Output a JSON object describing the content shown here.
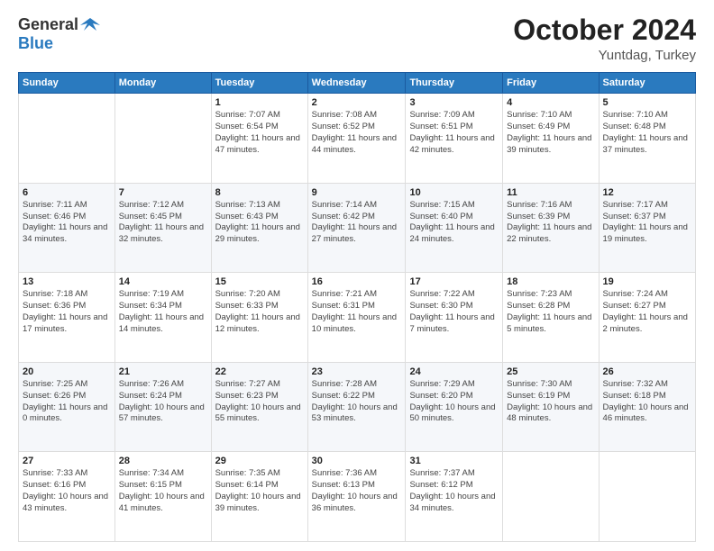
{
  "header": {
    "logo_general": "General",
    "logo_blue": "Blue",
    "month_title": "October 2024",
    "location": "Yuntdag, Turkey"
  },
  "weekdays": [
    "Sunday",
    "Monday",
    "Tuesday",
    "Wednesday",
    "Thursday",
    "Friday",
    "Saturday"
  ],
  "weeks": [
    [
      {
        "day": "",
        "sunrise": "",
        "sunset": "",
        "daylight": ""
      },
      {
        "day": "",
        "sunrise": "",
        "sunset": "",
        "daylight": ""
      },
      {
        "day": "1",
        "sunrise": "Sunrise: 7:07 AM",
        "sunset": "Sunset: 6:54 PM",
        "daylight": "Daylight: 11 hours and 47 minutes."
      },
      {
        "day": "2",
        "sunrise": "Sunrise: 7:08 AM",
        "sunset": "Sunset: 6:52 PM",
        "daylight": "Daylight: 11 hours and 44 minutes."
      },
      {
        "day": "3",
        "sunrise": "Sunrise: 7:09 AM",
        "sunset": "Sunset: 6:51 PM",
        "daylight": "Daylight: 11 hours and 42 minutes."
      },
      {
        "day": "4",
        "sunrise": "Sunrise: 7:10 AM",
        "sunset": "Sunset: 6:49 PM",
        "daylight": "Daylight: 11 hours and 39 minutes."
      },
      {
        "day": "5",
        "sunrise": "Sunrise: 7:10 AM",
        "sunset": "Sunset: 6:48 PM",
        "daylight": "Daylight: 11 hours and 37 minutes."
      }
    ],
    [
      {
        "day": "6",
        "sunrise": "Sunrise: 7:11 AM",
        "sunset": "Sunset: 6:46 PM",
        "daylight": "Daylight: 11 hours and 34 minutes."
      },
      {
        "day": "7",
        "sunrise": "Sunrise: 7:12 AM",
        "sunset": "Sunset: 6:45 PM",
        "daylight": "Daylight: 11 hours and 32 minutes."
      },
      {
        "day": "8",
        "sunrise": "Sunrise: 7:13 AM",
        "sunset": "Sunset: 6:43 PM",
        "daylight": "Daylight: 11 hours and 29 minutes."
      },
      {
        "day": "9",
        "sunrise": "Sunrise: 7:14 AM",
        "sunset": "Sunset: 6:42 PM",
        "daylight": "Daylight: 11 hours and 27 minutes."
      },
      {
        "day": "10",
        "sunrise": "Sunrise: 7:15 AM",
        "sunset": "Sunset: 6:40 PM",
        "daylight": "Daylight: 11 hours and 24 minutes."
      },
      {
        "day": "11",
        "sunrise": "Sunrise: 7:16 AM",
        "sunset": "Sunset: 6:39 PM",
        "daylight": "Daylight: 11 hours and 22 minutes."
      },
      {
        "day": "12",
        "sunrise": "Sunrise: 7:17 AM",
        "sunset": "Sunset: 6:37 PM",
        "daylight": "Daylight: 11 hours and 19 minutes."
      }
    ],
    [
      {
        "day": "13",
        "sunrise": "Sunrise: 7:18 AM",
        "sunset": "Sunset: 6:36 PM",
        "daylight": "Daylight: 11 hours and 17 minutes."
      },
      {
        "day": "14",
        "sunrise": "Sunrise: 7:19 AM",
        "sunset": "Sunset: 6:34 PM",
        "daylight": "Daylight: 11 hours and 14 minutes."
      },
      {
        "day": "15",
        "sunrise": "Sunrise: 7:20 AM",
        "sunset": "Sunset: 6:33 PM",
        "daylight": "Daylight: 11 hours and 12 minutes."
      },
      {
        "day": "16",
        "sunrise": "Sunrise: 7:21 AM",
        "sunset": "Sunset: 6:31 PM",
        "daylight": "Daylight: 11 hours and 10 minutes."
      },
      {
        "day": "17",
        "sunrise": "Sunrise: 7:22 AM",
        "sunset": "Sunset: 6:30 PM",
        "daylight": "Daylight: 11 hours and 7 minutes."
      },
      {
        "day": "18",
        "sunrise": "Sunrise: 7:23 AM",
        "sunset": "Sunset: 6:28 PM",
        "daylight": "Daylight: 11 hours and 5 minutes."
      },
      {
        "day": "19",
        "sunrise": "Sunrise: 7:24 AM",
        "sunset": "Sunset: 6:27 PM",
        "daylight": "Daylight: 11 hours and 2 minutes."
      }
    ],
    [
      {
        "day": "20",
        "sunrise": "Sunrise: 7:25 AM",
        "sunset": "Sunset: 6:26 PM",
        "daylight": "Daylight: 11 hours and 0 minutes."
      },
      {
        "day": "21",
        "sunrise": "Sunrise: 7:26 AM",
        "sunset": "Sunset: 6:24 PM",
        "daylight": "Daylight: 10 hours and 57 minutes."
      },
      {
        "day": "22",
        "sunrise": "Sunrise: 7:27 AM",
        "sunset": "Sunset: 6:23 PM",
        "daylight": "Daylight: 10 hours and 55 minutes."
      },
      {
        "day": "23",
        "sunrise": "Sunrise: 7:28 AM",
        "sunset": "Sunset: 6:22 PM",
        "daylight": "Daylight: 10 hours and 53 minutes."
      },
      {
        "day": "24",
        "sunrise": "Sunrise: 7:29 AM",
        "sunset": "Sunset: 6:20 PM",
        "daylight": "Daylight: 10 hours and 50 minutes."
      },
      {
        "day": "25",
        "sunrise": "Sunrise: 7:30 AM",
        "sunset": "Sunset: 6:19 PM",
        "daylight": "Daylight: 10 hours and 48 minutes."
      },
      {
        "day": "26",
        "sunrise": "Sunrise: 7:32 AM",
        "sunset": "Sunset: 6:18 PM",
        "daylight": "Daylight: 10 hours and 46 minutes."
      }
    ],
    [
      {
        "day": "27",
        "sunrise": "Sunrise: 7:33 AM",
        "sunset": "Sunset: 6:16 PM",
        "daylight": "Daylight: 10 hours and 43 minutes."
      },
      {
        "day": "28",
        "sunrise": "Sunrise: 7:34 AM",
        "sunset": "Sunset: 6:15 PM",
        "daylight": "Daylight: 10 hours and 41 minutes."
      },
      {
        "day": "29",
        "sunrise": "Sunrise: 7:35 AM",
        "sunset": "Sunset: 6:14 PM",
        "daylight": "Daylight: 10 hours and 39 minutes."
      },
      {
        "day": "30",
        "sunrise": "Sunrise: 7:36 AM",
        "sunset": "Sunset: 6:13 PM",
        "daylight": "Daylight: 10 hours and 36 minutes."
      },
      {
        "day": "31",
        "sunrise": "Sunrise: 7:37 AM",
        "sunset": "Sunset: 6:12 PM",
        "daylight": "Daylight: 10 hours and 34 minutes."
      },
      {
        "day": "",
        "sunrise": "",
        "sunset": "",
        "daylight": ""
      },
      {
        "day": "",
        "sunrise": "",
        "sunset": "",
        "daylight": ""
      }
    ]
  ]
}
